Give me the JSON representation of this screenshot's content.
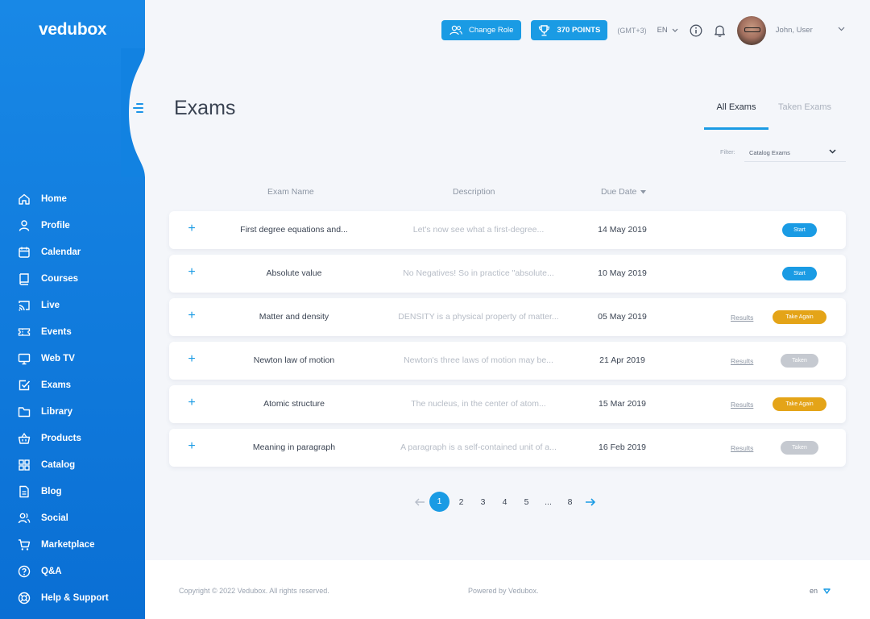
{
  "app": {
    "logo": "vedubox"
  },
  "sidebar": {
    "items": [
      {
        "label": "Home",
        "icon": "home-icon"
      },
      {
        "label": "Profile",
        "icon": "user-icon"
      },
      {
        "label": "Calendar",
        "icon": "calendar-icon"
      },
      {
        "label": "Courses",
        "icon": "book-icon"
      },
      {
        "label": "Live",
        "icon": "cast-icon"
      },
      {
        "label": "Events",
        "icon": "ticket-icon"
      },
      {
        "label": "Web TV",
        "icon": "monitor-icon"
      },
      {
        "label": "Exams",
        "icon": "checkbox-icon"
      },
      {
        "label": "Library",
        "icon": "folder-icon"
      },
      {
        "label": "Products",
        "icon": "basket-icon"
      },
      {
        "label": "Catalog",
        "icon": "grid-icon"
      },
      {
        "label": "Blog",
        "icon": "document-icon"
      },
      {
        "label": "Social",
        "icon": "users-icon"
      },
      {
        "label": "Marketplace",
        "icon": "cart-icon"
      },
      {
        "label": "Q&A",
        "icon": "question-icon"
      },
      {
        "label": "Help & Support",
        "icon": "lifebuoy-icon"
      }
    ]
  },
  "topbar": {
    "change_role": "Change Role",
    "points": "370 POINTS",
    "timezone": "(GMT+3)",
    "language": "EN",
    "username": "John, User"
  },
  "page": {
    "title": "Exams",
    "tabs": [
      {
        "label": "All Exams",
        "active": true
      },
      {
        "label": "Taken Exams",
        "active": false
      }
    ],
    "filter_label": "Filter:",
    "filter_value": "Catalog Exams"
  },
  "table": {
    "headers": {
      "name": "Exam Name",
      "description": "Description",
      "due": "Due Date"
    },
    "results_label": "Results",
    "rows": [
      {
        "name": "First degree equations and...",
        "description": "Let's now see what a first-degree...",
        "date": "14 May 2019",
        "results": false,
        "status": "Start",
        "status_type": "start"
      },
      {
        "name": "Absolute value",
        "description": "No Negatives! So in practice \"absolute...",
        "date": "10 May 2019",
        "results": false,
        "status": "Start",
        "status_type": "start"
      },
      {
        "name": "Matter and density",
        "description": "DENSITY is a physical property of matter...",
        "date": "05 May 2019",
        "results": true,
        "status": "Take Again",
        "status_type": "again"
      },
      {
        "name": "Newton law of motion",
        "description": "Newton's three laws of motion may be...",
        "date": "21 Apr 2019",
        "results": true,
        "status": "Taken",
        "status_type": "taken"
      },
      {
        "name": "Atomic structure",
        "description": "The nucleus, in the center of atom...",
        "date": "15 Mar 2019",
        "results": true,
        "status": "Take Again",
        "status_type": "again"
      },
      {
        "name": "Meaning in paragraph",
        "description": "A paragraph is a self-contained unit of a...",
        "date": "16 Feb 2019",
        "results": true,
        "status": "Taken",
        "status_type": "taken"
      }
    ]
  },
  "pagination": {
    "pages": [
      "1",
      "2",
      "3",
      "4",
      "5",
      "...",
      "8"
    ],
    "current": "1"
  },
  "footer": {
    "copyright": "Copyright © 2022 Vedubox. All rights reserved.",
    "powered": "Powered by Vedubox.",
    "language": "en"
  },
  "colors": {
    "primary": "#1a9be4",
    "sidebar": "#1283e2",
    "take_again": "#e4a418",
    "taken": "#c5c9d0"
  }
}
